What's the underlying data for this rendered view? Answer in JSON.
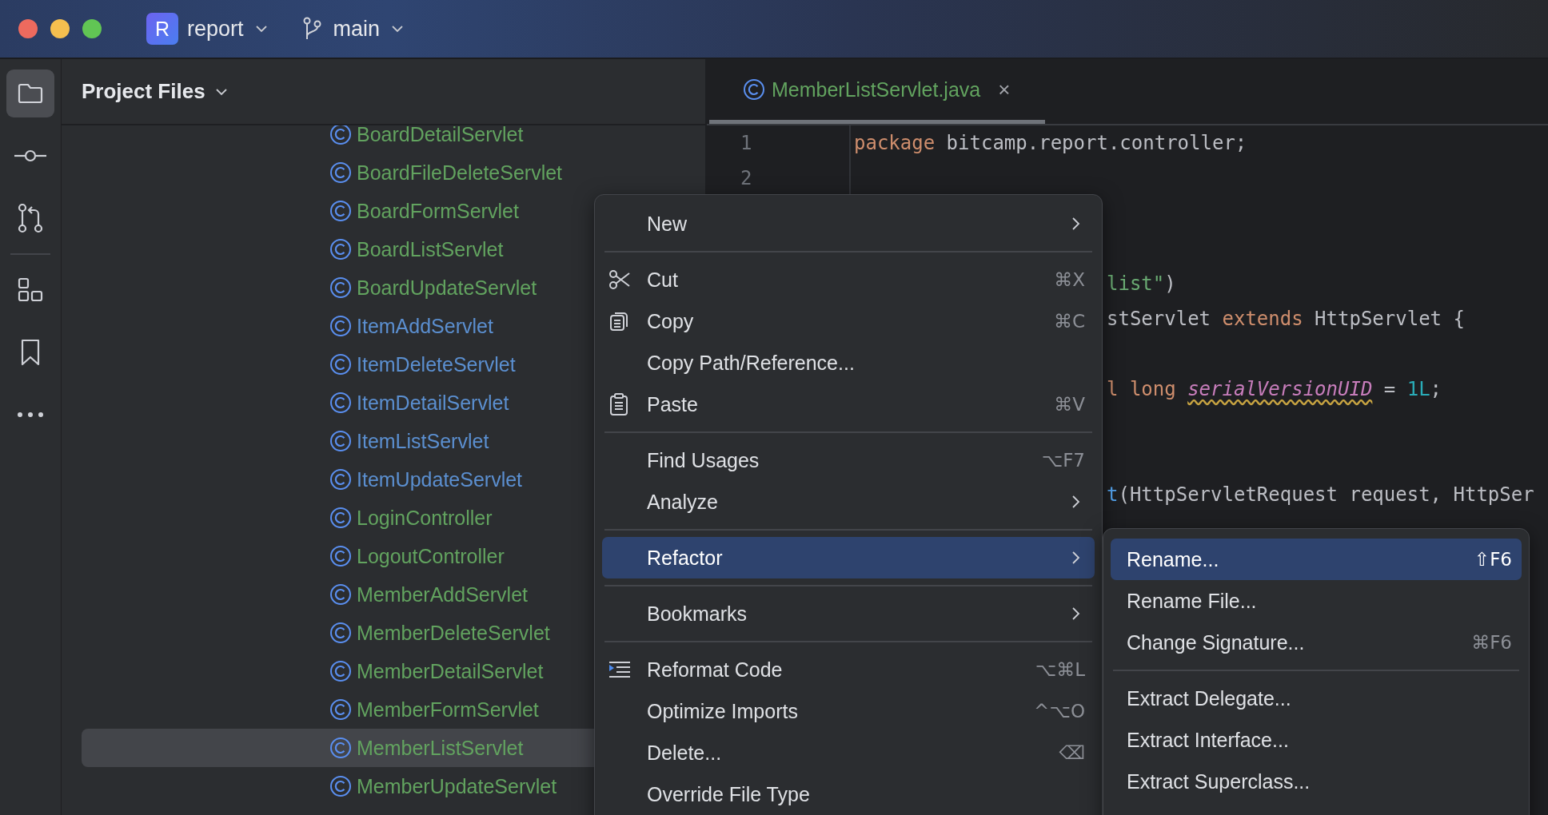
{
  "title_bar": {
    "project_badge": "R",
    "project": "report",
    "branch": "main"
  },
  "tool_strip": {
    "items": [
      {
        "selected": true
      },
      {
        "selected": false
      },
      {
        "selected": false
      },
      {
        "selected": false
      },
      {
        "selected": false
      },
      {
        "selected": false
      }
    ]
  },
  "project_panel": {
    "title": "Project Files",
    "files": [
      {
        "name": "BoardDetailServlet",
        "color": "#62a35f",
        "selected": false
      },
      {
        "name": "BoardFileDeleteServlet",
        "color": "#62a35f",
        "selected": false
      },
      {
        "name": "BoardFormServlet",
        "color": "#62a35f",
        "selected": false
      },
      {
        "name": "BoardListServlet",
        "color": "#62a35f",
        "selected": false
      },
      {
        "name": "BoardUpdateServlet",
        "color": "#62a35f",
        "selected": false
      },
      {
        "name": "ItemAddServlet",
        "color": "#5b8fd0",
        "selected": false
      },
      {
        "name": "ItemDeleteServlet",
        "color": "#5b8fd0",
        "selected": false
      },
      {
        "name": "ItemDetailServlet",
        "color": "#5b8fd0",
        "selected": false
      },
      {
        "name": "ItemListServlet",
        "color": "#5b8fd0",
        "selected": false
      },
      {
        "name": "ItemUpdateServlet",
        "color": "#5b8fd0",
        "selected": false
      },
      {
        "name": "LoginController",
        "color": "#62a35f",
        "selected": false
      },
      {
        "name": "LogoutController",
        "color": "#62a35f",
        "selected": false
      },
      {
        "name": "MemberAddServlet",
        "color": "#62a35f",
        "selected": false
      },
      {
        "name": "MemberDeleteServlet",
        "color": "#62a35f",
        "selected": false
      },
      {
        "name": "MemberDetailServlet",
        "color": "#62a35f",
        "selected": false
      },
      {
        "name": "MemberFormServlet",
        "color": "#62a35f",
        "selected": false
      },
      {
        "name": "MemberListServlet",
        "color": "#62a35f",
        "selected": true
      },
      {
        "name": "MemberUpdateServlet",
        "color": "#62a35f",
        "selected": false
      }
    ]
  },
  "editor": {
    "tabs": [
      {
        "label": "MemberListServlet.java",
        "close": "×",
        "selected": true
      }
    ],
    "lines": [
      {
        "kind": "full",
        "number": "1",
        "tokens": [
          {
            "kind": "keyword",
            "text": "package"
          },
          {
            "kind": "plain",
            "text": " bitcamp.report.controller;"
          }
        ]
      },
      {
        "kind": "full",
        "number": "2"
      },
      {
        "kind": "blank"
      },
      {
        "kind": "blank"
      },
      {
        "kind": "partial",
        "tokens": [
          {
            "kind": "string",
            "text": "list\""
          },
          {
            "kind": "plain",
            "text": ")"
          }
        ]
      },
      {
        "kind": "partial",
        "tokens": [
          {
            "kind": "plain",
            "text": "stServlet "
          },
          {
            "kind": "keyword",
            "text": "extends"
          },
          {
            "kind": "plain",
            "text": " HttpServlet {"
          }
        ]
      },
      {
        "kind": "blank"
      },
      {
        "kind": "partial",
        "tokens": [
          {
            "kind": "keyword",
            "text": "l long "
          },
          {
            "kind": "field",
            "text": "serialVersionUID"
          },
          {
            "kind": "plain",
            "text": " = "
          },
          {
            "kind": "number",
            "text": "1L"
          },
          {
            "kind": "plain",
            "text": ";"
          }
        ]
      },
      {
        "kind": "blank"
      },
      {
        "kind": "blank"
      },
      {
        "kind": "partial",
        "tokens": [
          {
            "kind": "method",
            "text": "t"
          },
          {
            "kind": "plain",
            "text": "(HttpServletRequest request, HttpSer"
          }
        ]
      }
    ]
  },
  "context_menu": {
    "items": [
      {
        "kind": "item",
        "label": "New",
        "submenu": true,
        "selected": false
      },
      {
        "kind": "separator"
      },
      {
        "kind": "item",
        "label": "Cut",
        "shortcut": "⌘X",
        "submenu": false,
        "selected": false
      },
      {
        "kind": "item",
        "label": "Copy",
        "shortcut": "⌘C",
        "submenu": false,
        "selected": false
      },
      {
        "kind": "item",
        "label": "Copy Path/Reference...",
        "submenu": false,
        "selected": false
      },
      {
        "kind": "item",
        "label": "Paste",
        "shortcut": "⌘V",
        "submenu": false,
        "selected": false
      },
      {
        "kind": "separator"
      },
      {
        "kind": "item",
        "label": "Find Usages",
        "shortcut": "⌥F7",
        "submenu": false,
        "selected": false
      },
      {
        "kind": "item",
        "label": "Analyze",
        "submenu": true,
        "selected": false
      },
      {
        "kind": "separator"
      },
      {
        "kind": "item",
        "label": "Refactor",
        "submenu": true,
        "selected": true
      },
      {
        "kind": "separator"
      },
      {
        "kind": "item",
        "label": "Bookmarks",
        "submenu": true,
        "selected": false
      },
      {
        "kind": "separator"
      },
      {
        "kind": "item",
        "label": "Reformat Code",
        "shortcut": "⌥⌘L",
        "submenu": false,
        "selected": false
      },
      {
        "kind": "item",
        "label": "Optimize Imports",
        "shortcut": "^⌥O",
        "submenu": false,
        "selected": false
      },
      {
        "kind": "item",
        "label": "Delete...",
        "shortcut": "⌫",
        "submenu": false,
        "selected": false
      },
      {
        "kind": "item",
        "label": "Override File Type",
        "submenu": false,
        "selected": false
      }
    ]
  },
  "refactor_submenu": {
    "items": [
      {
        "kind": "item",
        "label": "Rename...",
        "shortcut": "⇧F6",
        "selected": true
      },
      {
        "kind": "item",
        "label": "Rename File...",
        "selected": false
      },
      {
        "kind": "item",
        "label": "Change Signature...",
        "shortcut": "⌘F6",
        "selected": false
      },
      {
        "kind": "separator"
      },
      {
        "kind": "item",
        "label": "Extract Delegate...",
        "selected": false
      },
      {
        "kind": "item",
        "label": "Extract Interface...",
        "selected": false
      },
      {
        "kind": "item",
        "label": "Extract Superclass...",
        "selected": false
      }
    ]
  }
}
